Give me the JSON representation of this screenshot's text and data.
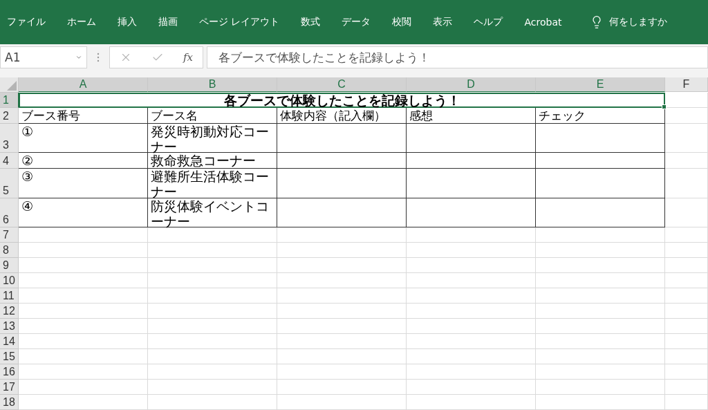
{
  "ribbon": {
    "tabs": [
      "ファイル",
      "ホーム",
      "挿入",
      "描画",
      "ページ レイアウト",
      "数式",
      "データ",
      "校閲",
      "表示",
      "ヘルプ",
      "Acrobat"
    ],
    "tell_me": "何をしますか"
  },
  "formula_bar": {
    "name_box": "A1",
    "buttons": [
      {
        "kind": "cancel",
        "disabled": true
      },
      {
        "kind": "enter",
        "disabled": true
      }
    ],
    "function_label": "fx",
    "formula": "各ブースで体験したことを記録しよう！"
  },
  "sheet": {
    "columns": [
      {
        "label": "A",
        "selected": true
      },
      {
        "label": "B",
        "selected": true
      },
      {
        "label": "C",
        "selected": true
      },
      {
        "label": "D",
        "selected": true
      },
      {
        "label": "E",
        "selected": true
      },
      {
        "label": "F",
        "selected": false
      }
    ],
    "title": {
      "row": "1",
      "text": "各ブースで体験したことを記録しよう！",
      "selected": true
    },
    "rows": [
      {
        "row": "2",
        "cells": [
          "ブース番号",
          "ブース名",
          "体験内容（記入欄）",
          "感想",
          "チェック"
        ]
      },
      {
        "row": "3",
        "cells": [
          "①",
          "発災時初動対応コーナー"
        ]
      },
      {
        "row": "4",
        "cells": [
          "②",
          "救命救急コーナー"
        ]
      },
      {
        "row": "5",
        "cells": [
          "③",
          "避難所生活体験コーナー"
        ]
      },
      {
        "row": "6",
        "cells": [
          "④",
          "防災体験イベントコーナー"
        ]
      }
    ],
    "empty_rows": [
      "7",
      "8",
      "9",
      "10",
      "11",
      "12",
      "13",
      "14",
      "15",
      "16",
      "17",
      "18"
    ]
  }
}
